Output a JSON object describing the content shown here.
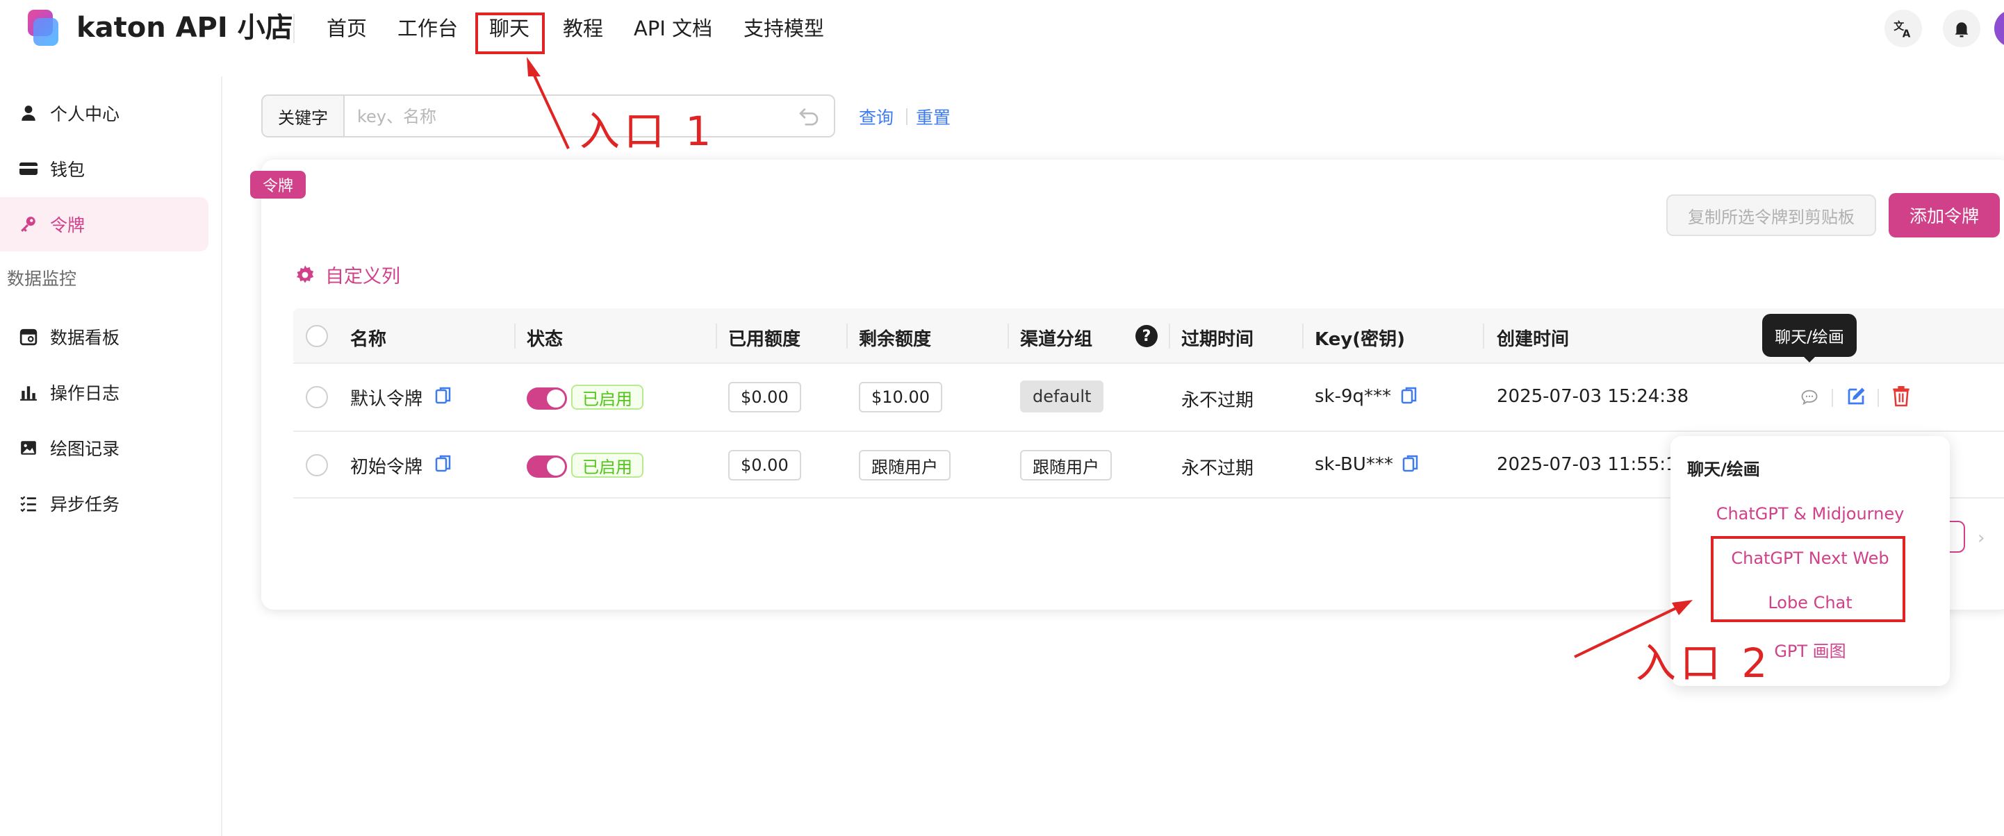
{
  "header": {
    "app_title": "katon API 小店",
    "nav": [
      "首页",
      "工作台",
      "聊天",
      "教程",
      "API 文档",
      "支持模型"
    ]
  },
  "sidebar": {
    "items_top": [
      "个人中心",
      "钱包",
      "令牌"
    ],
    "section_label": "数据监控",
    "items_bottom": [
      "数据看板",
      "操作日志",
      "绘图记录",
      "异步任务"
    ]
  },
  "search": {
    "addon": "关键字",
    "placeholder": "key、名称",
    "query_label": "查询",
    "reset_label": "重置"
  },
  "card": {
    "tag": "令牌",
    "copy_button": "复制所选令牌到剪贴板",
    "add_button": "添加令牌",
    "custom_columns": "自定义列"
  },
  "table": {
    "headers": [
      "名称",
      "状态",
      "已用额度",
      "剩余额度",
      "渠道分组",
      "过期时间",
      "Key(密钥)",
      "创建时间"
    ],
    "rows": [
      {
        "name": "默认令牌",
        "status": "已启用",
        "used": "$0.00",
        "remaining": "$10.00",
        "group": "default",
        "expire": "永不过期",
        "key": "sk-9q***",
        "created": "2025-07-03 15:24:38"
      },
      {
        "name": "初始令牌",
        "status": "已启用",
        "used": "$0.00",
        "remaining": "跟随用户",
        "group": "跟随用户",
        "expire": "永不过期",
        "key": "sk-BU***",
        "created": "2025-07-03 11:55:12"
      }
    ]
  },
  "tooltip": "聊天/绘画",
  "dropdown": {
    "title": "聊天/绘画",
    "items": [
      "ChatGPT & Midjourney",
      "ChatGPT Next Web",
      "Lobe Chat",
      "GPT 画图"
    ]
  },
  "annotations": {
    "entry1": "入口 1",
    "entry2": "入口 2"
  },
  "colors": {
    "brand": "#d0418a",
    "link": "#3e7bf0",
    "success": "#52c41a",
    "annotation": "#e02424"
  }
}
